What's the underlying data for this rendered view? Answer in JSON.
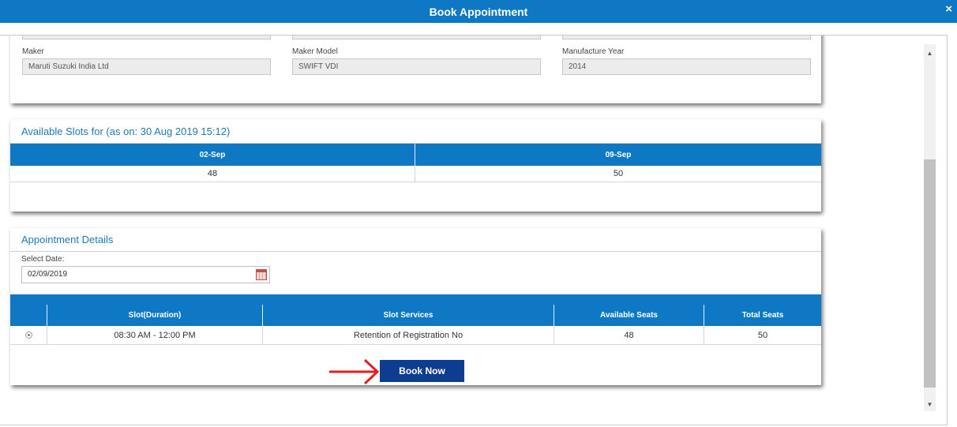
{
  "dialog": {
    "title": "Book Appointment",
    "close": "×"
  },
  "vehicle": {
    "maker_label": "Maker",
    "maker_value": "Maruti Suzuki India Ltd",
    "model_label": "Maker Model",
    "model_value": "SWIFT VDI",
    "year_label": "Manufacture Year",
    "year_value": "2014"
  },
  "slots": {
    "title": "Available Slots for (as on: 30 Aug 2019 15:12)",
    "columns": [
      "02-Sep",
      "09-Sep"
    ],
    "values": [
      "48",
      "50"
    ]
  },
  "appointment": {
    "title": "Appointment Details",
    "date_label": "Select Date:",
    "date_value": "02/09/2019",
    "columns": [
      "Slot(Duration)",
      "Slot Services",
      "Available Seats",
      "Total Seats"
    ],
    "row": {
      "slot": "08:30 AM - 12:00 PM",
      "service": "Retention of Registration No",
      "available": "48",
      "total": "50"
    },
    "book_label": "Book Now"
  },
  "colors": {
    "header_blue": "#0f78c4",
    "button_blue": "#0d3d8f",
    "arrow_red": "#e02020"
  },
  "icons": {
    "calendar": "calendar-icon",
    "close": "close-icon"
  }
}
